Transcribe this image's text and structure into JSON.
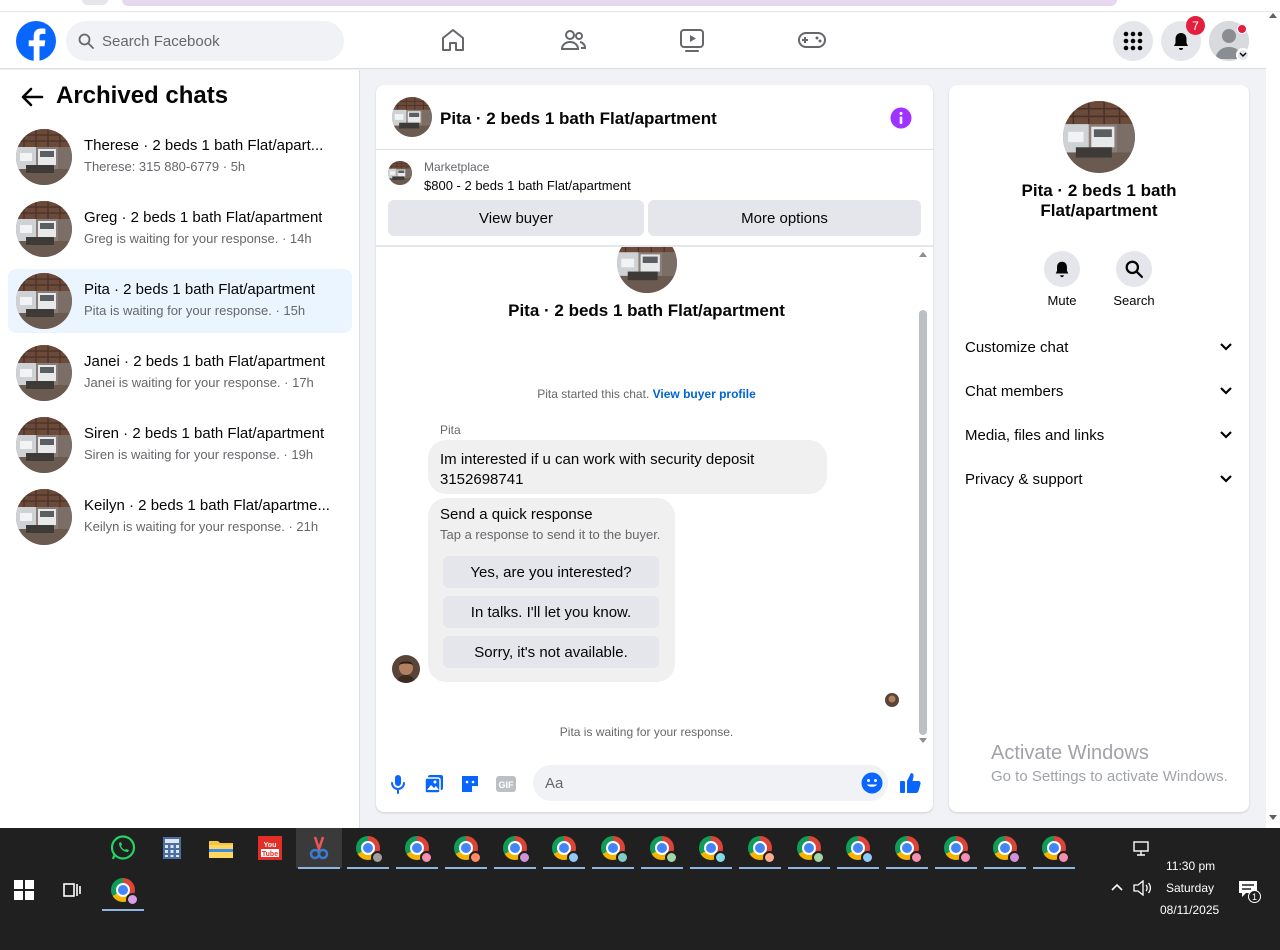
{
  "header": {
    "search_placeholder": "Search Facebook",
    "notification_count": "7"
  },
  "sidebar": {
    "title": "Archived chats",
    "chats": [
      {
        "name": "Therese · 2 beds 1 bath Flat/apart...",
        "preview": "Therese: 315 880-6779 · 5h"
      },
      {
        "name": "Greg · 2 beds 1 bath Flat/apartment",
        "preview": "Greg is waiting for your response. · 14h"
      },
      {
        "name": "Pita · 2 beds 1 bath Flat/apartment",
        "preview": "Pita is waiting for your response. · 15h"
      },
      {
        "name": "Janei · 2 beds 1 bath Flat/apartment",
        "preview": "Janei is waiting for your response. · 17h"
      },
      {
        "name": "Siren · 2 beds 1 bath Flat/apartment",
        "preview": "Siren is waiting for your response. · 19h"
      },
      {
        "name": "Keilyn · 2 beds 1 bath Flat/apartme...",
        "preview": "Keilyn is waiting for your response. · 21h"
      }
    ]
  },
  "conversation": {
    "title": "Pita · 2 beds 1 bath Flat/apartment",
    "marketplace_label": "Marketplace",
    "listing": "$800 - 2 beds 1 bath Flat/apartment",
    "view_buyer": "View buyer",
    "more_options": "More options",
    "intro_name": "Pita · 2 beds 1 bath Flat/apartment",
    "started_text": "Pita started this chat.",
    "view_buyer_profile": "View buyer profile",
    "sender": "Pita",
    "message_line1": "Im interested  if u can work with security  deposit",
    "message_line2": "3152698741",
    "quick_title": "Send a quick response",
    "quick_subtitle": "Tap a response to send it to the buyer.",
    "quick_responses": [
      "Yes, are you interested?",
      "In talks. I'll let you know.",
      "Sorry, it's not available."
    ],
    "waiting_text": "Pita is waiting for your response.",
    "composer_placeholder": "Aa"
  },
  "details": {
    "name": "Pita · 2 beds 1 bath Flat/apartment",
    "mute_label": "Mute",
    "search_label": "Search",
    "sections": [
      "Customize chat",
      "Chat members",
      "Media, files and links",
      "Privacy & support"
    ],
    "watermark_title": "Activate Windows",
    "watermark_sub": "Go to Settings to activate Windows."
  },
  "taskbar": {
    "time": "11:30 pm",
    "day": "Saturday",
    "date": "08/11/2025",
    "notification_count": "1"
  },
  "colors": {
    "facebook_blue": "#0866ff",
    "messenger_purple": "#a033ff",
    "badge_red": "#e41e3f",
    "active_chat_bg": "#ebf5ff",
    "taskbar_bg": "#202020"
  }
}
